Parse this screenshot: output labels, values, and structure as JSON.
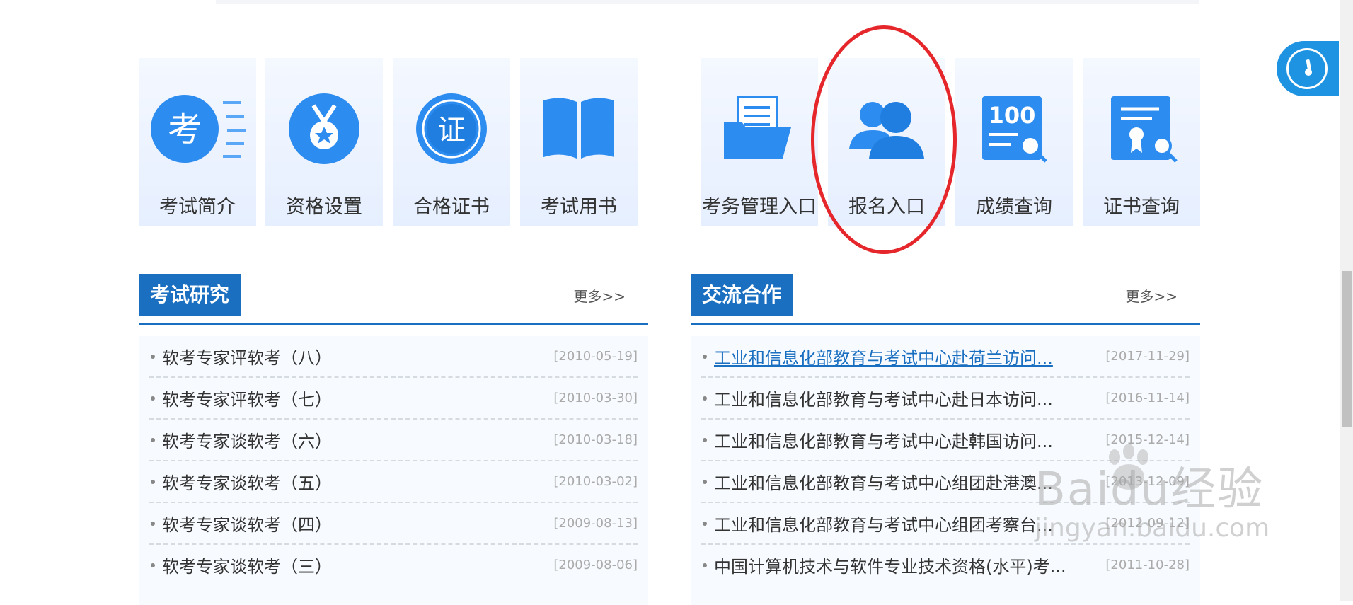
{
  "tiles": [
    {
      "label": "考试简介",
      "icon": "exam-intro-icon"
    },
    {
      "label": "资格设置",
      "icon": "medal-icon"
    },
    {
      "label": "合格证书",
      "icon": "certificate-seal-icon"
    },
    {
      "label": "考试用书",
      "icon": "book-icon"
    },
    {
      "label": "考务管理入口",
      "icon": "folder-documents-icon"
    },
    {
      "label": "报名入口",
      "icon": "users-icon"
    },
    {
      "label": "成绩查询",
      "icon": "score-search-icon"
    },
    {
      "label": "证书查询",
      "icon": "certificate-search-icon"
    }
  ],
  "icon_glyphs": {
    "exam": "考",
    "cert": "证",
    "score": "100"
  },
  "colors": {
    "brand": "#1a6fc0",
    "icon_blue": "#2d8cf0",
    "highlight": "#e5262b"
  },
  "left_panel": {
    "title": "考试研究",
    "more": "更多>>",
    "rows": [
      {
        "title": "软考专家评软考（八）",
        "date": "[2010-05-19]"
      },
      {
        "title": "软考专家评软考（七）",
        "date": "[2010-03-30]"
      },
      {
        "title": "软考专家谈软考（六）",
        "date": "[2010-03-18]"
      },
      {
        "title": "软考专家谈软考（五）",
        "date": "[2010-03-02]"
      },
      {
        "title": "软考专家谈软考（四）",
        "date": "[2009-08-13]"
      },
      {
        "title": "软考专家谈软考（三）",
        "date": "[2009-08-06]"
      }
    ]
  },
  "right_panel": {
    "title": "交流合作",
    "more": "更多>>",
    "rows": [
      {
        "title": "工业和信息化部教育与考试中心赴荷兰访问...",
        "date": "[2017-11-29]"
      },
      {
        "title": "工业和信息化部教育与考试中心赴日本访问...",
        "date": "[2016-11-14]"
      },
      {
        "title": "工业和信息化部教育与考试中心赴韩国访问...",
        "date": "[2015-12-14]"
      },
      {
        "title": "工业和信息化部教育与考试中心组团赴港澳...",
        "date": "[2013-12-09]"
      },
      {
        "title": "工业和信息化部教育与考试中心组团考察台...",
        "date": "[2012-09-12]"
      },
      {
        "title": "中国计算机技术与软件专业技术资格(水平)考...",
        "date": "[2011-10-28]"
      }
    ]
  },
  "watermark": {
    "brand": "Baidu经验",
    "url": "jingyan.baidu.com"
  }
}
